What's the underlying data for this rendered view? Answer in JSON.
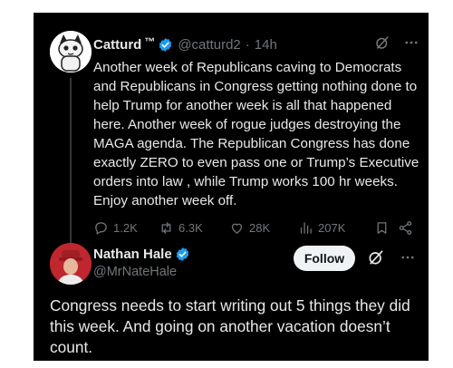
{
  "tweet": {
    "author_name": "Catturd",
    "trademark": "™",
    "handle": "@catturd2",
    "separator": "·",
    "time": "14h",
    "text": "Another week of Republicans caving to Democrats and Republicans in Congress getting nothing done to help Trump for another week is all that happened here. Another week of rogue judges destroying the MAGA agenda. The Republican Congress has done exactly ZERO to even pass one or Trump’s Executive orders into law , while Trump works 100 hr weeks. Enjoy another week off.",
    "stats": {
      "replies": "1.2K",
      "reposts": "6.3K",
      "likes": "28K",
      "views": "207K"
    }
  },
  "reply": {
    "author_name": "Nathan Hale",
    "handle": "@MrNateHale",
    "follow_label": "Follow",
    "text": "Congress needs to start writing out 5 things they did this week. And going on another vacation doesn’t count."
  },
  "icons": {
    "verified": "verified-badge-icon",
    "grok": "grok-icon",
    "more": "more-icon",
    "reply": "reply-icon",
    "repost": "repost-icon",
    "like": "like-icon",
    "views": "views-icon",
    "bookmark": "bookmark-icon",
    "share": "share-icon"
  },
  "colors": {
    "background": "#000000",
    "text": "#e7e9ea",
    "muted": "#71767b",
    "verified_blue": "#1d9bf0",
    "follow_bg": "#eff3f4"
  }
}
